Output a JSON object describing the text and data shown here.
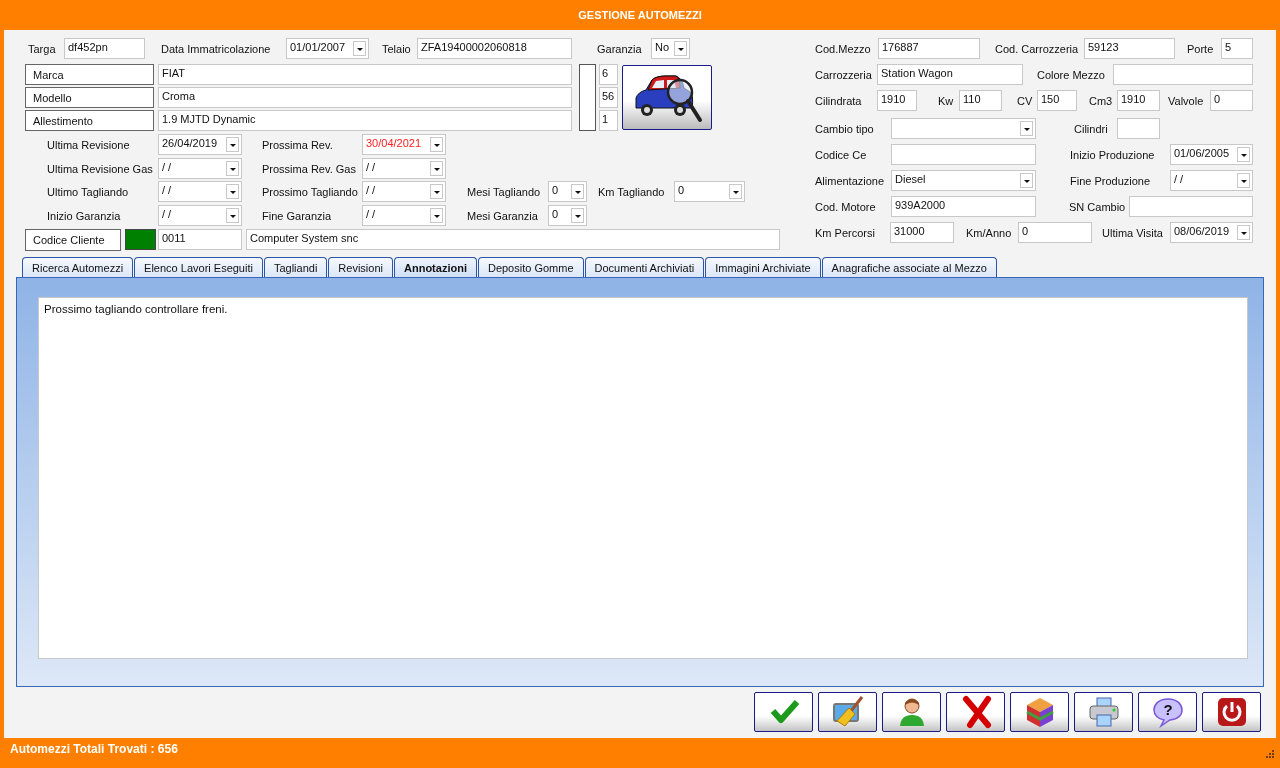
{
  "window": {
    "title": "GESTIONE AUTOMEZZI"
  },
  "top_row": {
    "items": [
      {
        "kind": "label",
        "text": "Targa"
      },
      {
        "kind": "field",
        "value": "df452pn"
      },
      {
        "kind": "label",
        "text": "Data Immatricolazione"
      },
      {
        "kind": "date",
        "value": "01/01/2007",
        "alert": false
      },
      {
        "kind": "label",
        "text": "Telaio"
      },
      {
        "kind": "field",
        "value": "ZFA19400002060818"
      },
      {
        "kind": "label",
        "text": "Garanzia"
      },
      {
        "kind": "combo",
        "value": "No"
      }
    ]
  },
  "model_rows": [
    {
      "label": "Marca",
      "value": "FIAT",
      "code": "6"
    },
    {
      "label": "Modello",
      "value": "Croma",
      "code": "56"
    },
    {
      "label": "Allestimento",
      "value": "1.9 MJTD Dynamic",
      "code": "1"
    }
  ],
  "date_rows": [
    {
      "items": [
        {
          "kind": "label",
          "text": "Ultima Revisione"
        },
        {
          "kind": "date",
          "value": "26/04/2019",
          "alert": false
        },
        {
          "kind": "label",
          "text": "Prossima Rev."
        },
        {
          "kind": "date",
          "value": "30/04/2021",
          "alert": true
        }
      ]
    },
    {
      "items": [
        {
          "kind": "label",
          "text": "Ultima Revisione Gas"
        },
        {
          "kind": "date",
          "value": "/ /",
          "alert": false
        },
        {
          "kind": "label",
          "text": "Prossima Rev. Gas"
        },
        {
          "kind": "date",
          "value": "/ /",
          "alert": false
        }
      ]
    },
    {
      "items": [
        {
          "kind": "label",
          "text": "Ultimo Tagliando"
        },
        {
          "kind": "date",
          "value": "/ /",
          "alert": false
        },
        {
          "kind": "label",
          "text": "Prossimo Tagliando"
        },
        {
          "kind": "date",
          "value": "/ /",
          "alert": false
        },
        {
          "kind": "label",
          "text": "Mesi Tagliando"
        },
        {
          "kind": "combo",
          "value": "0"
        },
        {
          "kind": "label",
          "text": "Km Tagliando"
        },
        {
          "kind": "combo",
          "value": "0"
        }
      ]
    },
    {
      "items": [
        {
          "kind": "label",
          "text": "Inizio Garanzia"
        },
        {
          "kind": "date",
          "value": "/ /",
          "alert": false
        },
        {
          "kind": "label",
          "text": "Fine Garanzia"
        },
        {
          "kind": "date",
          "value": "/ /",
          "alert": false
        },
        {
          "kind": "label",
          "text": "Mesi Garanzia"
        },
        {
          "kind": "combo",
          "value": "0"
        }
      ]
    }
  ],
  "customer_row": {
    "items": [
      {
        "kind": "button",
        "text": "Codice Cliente"
      },
      {
        "kind": "swatch",
        "color": "#008000"
      },
      {
        "kind": "field",
        "value": "0011"
      },
      {
        "kind": "field",
        "value": "Computer System snc"
      }
    ]
  },
  "right_rows": [
    {
      "items": [
        {
          "kind": "label",
          "text": "Cod.Mezzo"
        },
        {
          "kind": "field",
          "value": "176887"
        },
        {
          "kind": "label",
          "text": "Cod. Carrozzeria"
        },
        {
          "kind": "field",
          "value": "59123"
        },
        {
          "kind": "label",
          "text": "Porte"
        },
        {
          "kind": "field",
          "value": "5"
        }
      ]
    },
    {
      "items": [
        {
          "kind": "label",
          "text": "Carrozzeria"
        },
        {
          "kind": "field",
          "value": "Station Wagon"
        },
        {
          "kind": "label",
          "text": "Colore Mezzo"
        },
        {
          "kind": "field"
        }
      ]
    },
    {
      "items": [
        {
          "kind": "label",
          "text": "Cilindrata"
        },
        {
          "kind": "field",
          "value": "1910"
        },
        {
          "kind": "label",
          "text": "Kw"
        },
        {
          "kind": "field",
          "value": "110"
        },
        {
          "kind": "label",
          "text": "CV"
        },
        {
          "kind": "field",
          "value": "150"
        },
        {
          "kind": "label",
          "text": "Cm3"
        },
        {
          "kind": "field",
          "value": "1910"
        },
        {
          "kind": "label",
          "text": "Valvole"
        },
        {
          "kind": "field",
          "value": "0"
        }
      ]
    },
    {
      "items": [
        {
          "kind": "label",
          "text": "Cambio tipo"
        },
        {
          "kind": "combo"
        },
        {
          "kind": "label",
          "text": "Cilindri"
        },
        {
          "kind": "field"
        }
      ]
    },
    {
      "items": [
        {
          "kind": "label",
          "text": "Codice Ce"
        },
        {
          "kind": "field"
        },
        {
          "kind": "label",
          "text": "Inizio Produzione"
        },
        {
          "kind": "date",
          "value": "01/06/2005",
          "alert": false
        }
      ]
    },
    {
      "items": [
        {
          "kind": "label",
          "text": "Alimentazione"
        },
        {
          "kind": "combo",
          "value": "Diesel"
        },
        {
          "kind": "label",
          "text": "Fine Produzione"
        },
        {
          "kind": "date",
          "value": "/ /",
          "alert": false
        }
      ]
    },
    {
      "items": [
        {
          "kind": "label",
          "text": "Cod. Motore"
        },
        {
          "kind": "field",
          "value": "939A2000"
        },
        {
          "kind": "label",
          "text": "SN Cambio"
        },
        {
          "kind": "field"
        }
      ]
    },
    {
      "items": [
        {
          "kind": "label",
          "text": "Km Percorsi"
        },
        {
          "kind": "field",
          "value": "31000"
        },
        {
          "kind": "label",
          "text": "Km/Anno"
        },
        {
          "kind": "field",
          "value": "0"
        },
        {
          "kind": "label",
          "text": "Ultima Visita"
        },
        {
          "kind": "date",
          "value": "08/06/2019",
          "alert": false
        }
      ]
    }
  ],
  "tabs": [
    {
      "label": "Ricerca Automezzi",
      "selected": false
    },
    {
      "label": "Elenco Lavori Eseguiti",
      "selected": false
    },
    {
      "label": "Tagliandi",
      "selected": false
    },
    {
      "label": "Revisioni",
      "selected": false
    },
    {
      "label": "Annotazioni",
      "selected": true
    },
    {
      "label": "Deposito Gomme",
      "selected": false
    },
    {
      "label": "Documenti Archiviati",
      "selected": false
    },
    {
      "label": "Immagini Archiviate",
      "selected": false
    },
    {
      "label": "Anagrafiche associate al Mezzo",
      "selected": false
    }
  ],
  "notes": {
    "text": "Prossimo tagliando controllare freni."
  },
  "toolbar": [
    {
      "kind": "confirm"
    },
    {
      "kind": "clear"
    },
    {
      "kind": "customer"
    },
    {
      "kind": "delete"
    },
    {
      "kind": "cube"
    },
    {
      "kind": "print"
    },
    {
      "kind": "help",
      "glyph": "?"
    },
    {
      "kind": "exit"
    }
  ],
  "status_bar": {
    "text": "Automezzi Totali Trovati : 656"
  }
}
